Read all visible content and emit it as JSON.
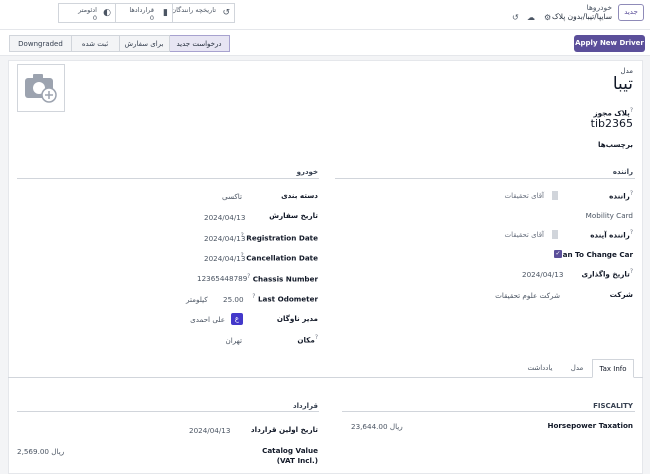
{
  "topbar": {
    "new_button": "جدید",
    "breadcrumb_parent": "خودروها",
    "breadcrumb_current": "سایپا/تیبا/بدون پلاک",
    "stats": [
      {
        "label": "تاریخچه رانندگان",
        "value": "",
        "icon": "history-icon"
      },
      {
        "label": "قراردادها",
        "value": "0",
        "icon": "book-icon"
      },
      {
        "label": "ادئومتر",
        "value": "0",
        "icon": "tachometer-icon"
      }
    ]
  },
  "control": {
    "apply_button": "Apply New Driver",
    "stages": [
      "درخواست جدید",
      "برای سفارش",
      "ثبت شده",
      "Downgraded"
    ],
    "active_stage": "درخواست جدید"
  },
  "form": {
    "model_label": "مدل",
    "model_value": "تیبا",
    "plate_label": "پلاک مجوز",
    "plate_value": "tib2365",
    "tags_label": "برچسب‌ها",
    "driver_section": "راننده",
    "driver_label": "راننده",
    "driver_placeholder": "آقای تحقیقات",
    "mobility_card_label": "Mobility Card",
    "future_driver_label": "راننده آینده",
    "future_driver_placeholder": "آقای تحقیقات",
    "plan_change_label": "Plan To Change Car",
    "assign_date_label": "تاریخ واگذاری",
    "assign_date_value": "2024/04/13",
    "company_label": "شرکت",
    "company_value": "شرکت علوم تحقیقات",
    "car_section": "خودرو",
    "category_label": "دسته بندی",
    "category_value": "تاکسی",
    "order_date_label": "تاریخ سفارش",
    "order_date_value": "2024/04/13",
    "registration_date_label": "Registration Date",
    "registration_date_value": "2024/04/13",
    "cancellation_date_label": "Cancellation Date",
    "cancellation_date_value": "2024/04/13",
    "chassis_label": "Chassis Number",
    "chassis_value": "12365448789",
    "odometer_label": "Last Odometer",
    "odometer_value": "25.00",
    "odometer_unit": "کیلومتر",
    "fleet_manager_label": "مدیر ناوگان",
    "fleet_manager_initial": "ع",
    "fleet_manager_value": "علی احمدی",
    "location_label": "مکان",
    "location_value": "تهران"
  },
  "tabs": [
    "Tax Info",
    "مدل",
    "یادداشت"
  ],
  "active_tab": "Tax Info",
  "tax": {
    "fiscality_section": "FISCALITY",
    "horsepower_label": "Horsepower Taxation",
    "horsepower_value": "23,644.00 ریال",
    "contract_section": "قرارداد",
    "first_contract_label": "تاریخ اولین قرارداد",
    "first_contract_value": "2024/04/13",
    "catalog_label": "Catalog Value (VAT Incl.)",
    "catalog_value": "2,569.00 ریال"
  },
  "colors": {
    "accent": "#5b4f9a",
    "pipeline_active": "#e7e5f3"
  }
}
